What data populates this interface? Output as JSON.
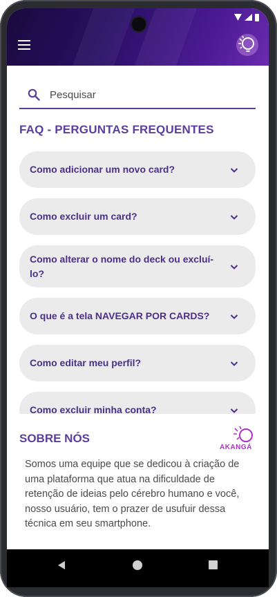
{
  "search": {
    "placeholder": "Pesquisar"
  },
  "faq": {
    "title": "FAQ - PERGUNTAS FREQUENTES",
    "items": [
      {
        "question": "Como adicionar um novo card?"
      },
      {
        "question": "Como excluir um card?"
      },
      {
        "question": "Como alterar o nome do deck ou excluí-lo?"
      },
      {
        "question": "O que é a tela NAVEGAR POR CARDS?"
      },
      {
        "question": "Como editar meu perfil?"
      },
      {
        "question": "Como excluir minha conta?"
      }
    ]
  },
  "about": {
    "title": "SOBRE NÓS",
    "logo_text": "AKANGÁ",
    "text": "Somos uma equipe que se dedicou à criação de uma plataforma que atua na dificuldade de retenção de ideias pelo cérebro humano e você, nosso usuário, tem o prazer de usufuir dessa técnica em seu smartphone."
  },
  "colors": {
    "accent": "#5a3e9e",
    "card_bg": "#ebebeb",
    "appbar": "#2a0f66",
    "logo": "#b030c8"
  },
  "icons": {
    "menu": "menu-icon",
    "logo": "lightbulb-logo-icon",
    "search": "search-icon",
    "chevron": "chevron-down-icon"
  }
}
